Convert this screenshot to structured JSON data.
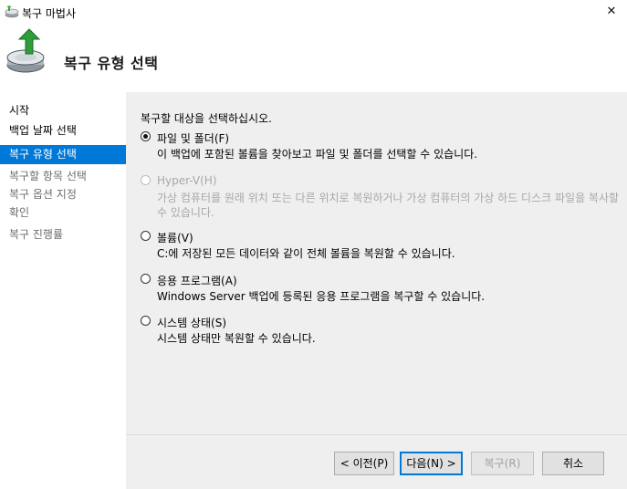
{
  "window": {
    "title": "복구 마법사",
    "close_glyph": "✕"
  },
  "header": {
    "heading": "복구 유형 선택"
  },
  "sidebar": {
    "items": [
      {
        "label": "시작",
        "state": "normal"
      },
      {
        "label": "백업 날짜 선택",
        "state": "normal"
      },
      {
        "label": "복구 유형 선택",
        "state": "active"
      },
      {
        "label": "복구할 항목 선택",
        "state": "disabled"
      },
      {
        "label": "복구 옵션 지정",
        "state": "disabled"
      },
      {
        "label": "확인",
        "state": "disabled"
      },
      {
        "label": "복구 진행률",
        "state": "disabled"
      }
    ]
  },
  "main": {
    "prompt": "복구할 대상을 선택하십시오.",
    "options": [
      {
        "label": "파일 및 폴더(F)",
        "desc": "이 백업에 포함된 볼륨을 찾아보고 파일 및 폴더를 선택할 수 있습니다.",
        "checked": true,
        "enabled": true
      },
      {
        "label": "Hyper-V(H)",
        "desc": "가상 컴퓨터를 원래 위치 또는 다른 위치로 복원하거나 가상 컴퓨터의 가상 하드 디스크 파일을 복사할 수 있습니다.",
        "checked": false,
        "enabled": false
      },
      {
        "label": "볼륨(V)",
        "desc": "C:에 저장된 모든 데이터와 같이 전체 볼륨을 복원할 수 있습니다.",
        "checked": false,
        "enabled": true
      },
      {
        "label": "응용 프로그램(A)",
        "desc": "Windows Server 백업에 등록된 응용 프로그램을 복구할 수 있습니다.",
        "checked": false,
        "enabled": true
      },
      {
        "label": "시스템 상태(S)",
        "desc": "시스템 상태만 복원할 수 있습니다.",
        "checked": false,
        "enabled": true
      }
    ]
  },
  "footer": {
    "back": "< 이전(P)",
    "next": "다음(N) >",
    "recover": "복구(R)",
    "cancel": "취소"
  },
  "colors": {
    "accent": "#0078d7",
    "content_bg": "#efefef"
  }
}
